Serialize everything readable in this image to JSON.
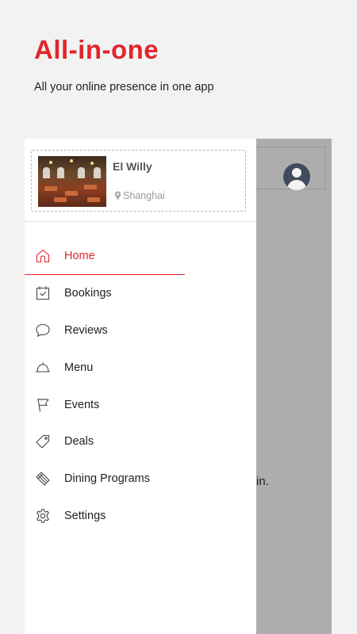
{
  "hero": {
    "title": "All-in-one",
    "subtitle": "All your online presence in one app"
  },
  "restaurant": {
    "name": "El Willy",
    "location": "Shanghai"
  },
  "background_text": "in.",
  "menu": {
    "active_index": 0,
    "items": [
      {
        "label": "Home",
        "icon": "home-icon"
      },
      {
        "label": "Bookings",
        "icon": "calendar-check-icon"
      },
      {
        "label": "Reviews",
        "icon": "chat-bubble-icon"
      },
      {
        "label": "Menu",
        "icon": "cloche-icon"
      },
      {
        "label": "Events",
        "icon": "flag-icon"
      },
      {
        "label": "Deals",
        "icon": "tag-icon"
      },
      {
        "label": "Dining Programs",
        "icon": "ticket-icon"
      },
      {
        "label": "Settings",
        "icon": "gear-icon"
      }
    ]
  },
  "colors": {
    "accent": "#e1262b",
    "overlay": "#adadad",
    "background": "#f2f2f2"
  }
}
